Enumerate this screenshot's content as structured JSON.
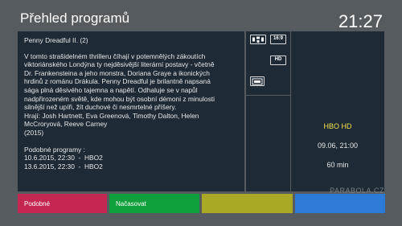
{
  "header": {
    "title": "Přehled programů",
    "clock": "21:27"
  },
  "program": {
    "title": "Penny Dreadful II. (2)",
    "description": [
      "V tomto strašidelném thrilleru číhají v potemnělých zákoutích",
      "viktoriánského Londýna ty nejděsivější literární postavy - včetně",
      "Dr. Frankensteina a jeho monstra, Doriana Graye a ikonických",
      "hrdinů z románu Drákula. Penny Dreadful je brilantně napsaná",
      "sága plná děsivého tajemna a napětí. Odhaluje se v napůl",
      "nadpřirozeném světě, kde mohou být osobní démoni z minulosti",
      "silnější než upíři, žít duchové či nesmrtelné příšery."
    ],
    "cast": [
      "Hrají: Josh Hartnett, Eva Greenová, Timothy Dalton, Helen",
      "McCroryová, Reeve Carney"
    ],
    "year": "(2015)",
    "repeats_label": "Podobné programy :",
    "repeats": [
      "10.6.2015, 22:30  -  HBO2",
      "13.6.2015, 22:30  -  HBO2"
    ]
  },
  "icons": {
    "surround": "surround-sound-icon",
    "aspect": "16:9",
    "hd": "HD",
    "teletext": "teletext-icon"
  },
  "info": {
    "channel": "HBO HD",
    "datetime": "09.06, 21:00",
    "duration": "60 min"
  },
  "watermark": "PARABOLA.CZ",
  "buttons": {
    "red": "Podobné",
    "green": "Načasovat",
    "yellow": "",
    "blue": ""
  },
  "colors": {
    "background": "#555b5f",
    "panel": "#1e2a36",
    "channel": "#f3e14a",
    "red": "#c42652",
    "green": "#0f9f3b",
    "yellow": "#a9a925",
    "blue": "#2d7bd6"
  }
}
